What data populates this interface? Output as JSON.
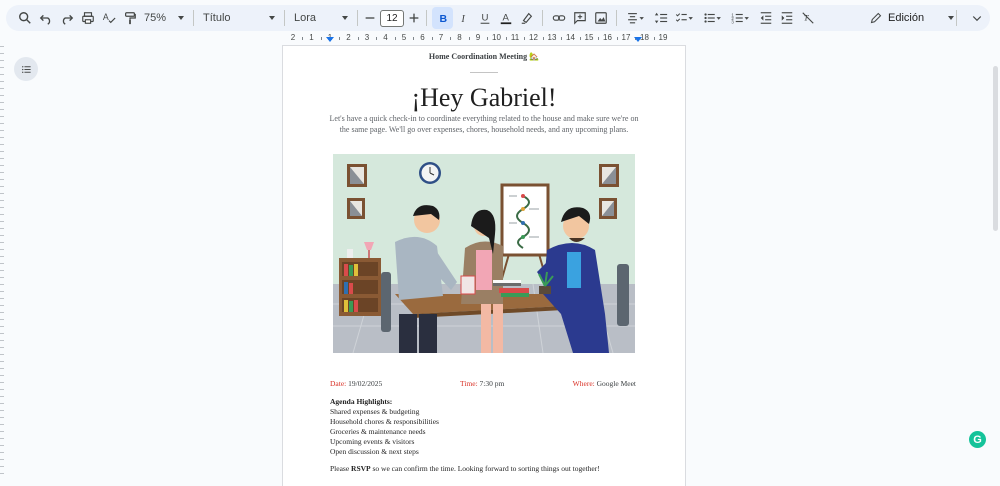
{
  "toolbar": {
    "zoom": "75%",
    "style": "Título",
    "font": "Lora",
    "font_size": "12",
    "mode": "Edición"
  },
  "ruler": {
    "labels": [
      "2",
      "1",
      "1",
      "2",
      "3",
      "4",
      "5",
      "6",
      "7",
      "8",
      "9",
      "10",
      "11",
      "12",
      "13",
      "14",
      "15",
      "16",
      "17",
      "18",
      "19"
    ]
  },
  "document": {
    "header": "Home Coordination Meeting 🏡",
    "dots": "..............",
    "title": "¡Hey Gabriel!",
    "intro": "Let's have a quick check-in to coordinate everything related to the house and make sure we're on the same page. We'll go over expenses, chores, household needs, and any upcoming plans.",
    "date_label": "Date:",
    "date_value": "19/02/2025",
    "time_label": "Time:",
    "time_value": "7:30 pm",
    "where_label": "Where:",
    "where_value": "Google Meet",
    "agenda_heading": "Agenda Highlights:",
    "agenda_items": [
      "Shared expenses & budgeting",
      "Household chores & responsibilities",
      "Groceries & maintenance needs",
      "Upcoming events & visitors",
      "Open discussion & next steps"
    ],
    "rsvp_pre": "Please ",
    "rsvp_bold": "RSVP",
    "rsvp_post": " so we can confirm the time. Looking forward to sorting things out together!"
  },
  "colors": {
    "accent_red": "#d93025",
    "toolbar_bg": "#edf2fa",
    "active_btn": "#d3e3fd",
    "grammarly": "#15c39a"
  }
}
